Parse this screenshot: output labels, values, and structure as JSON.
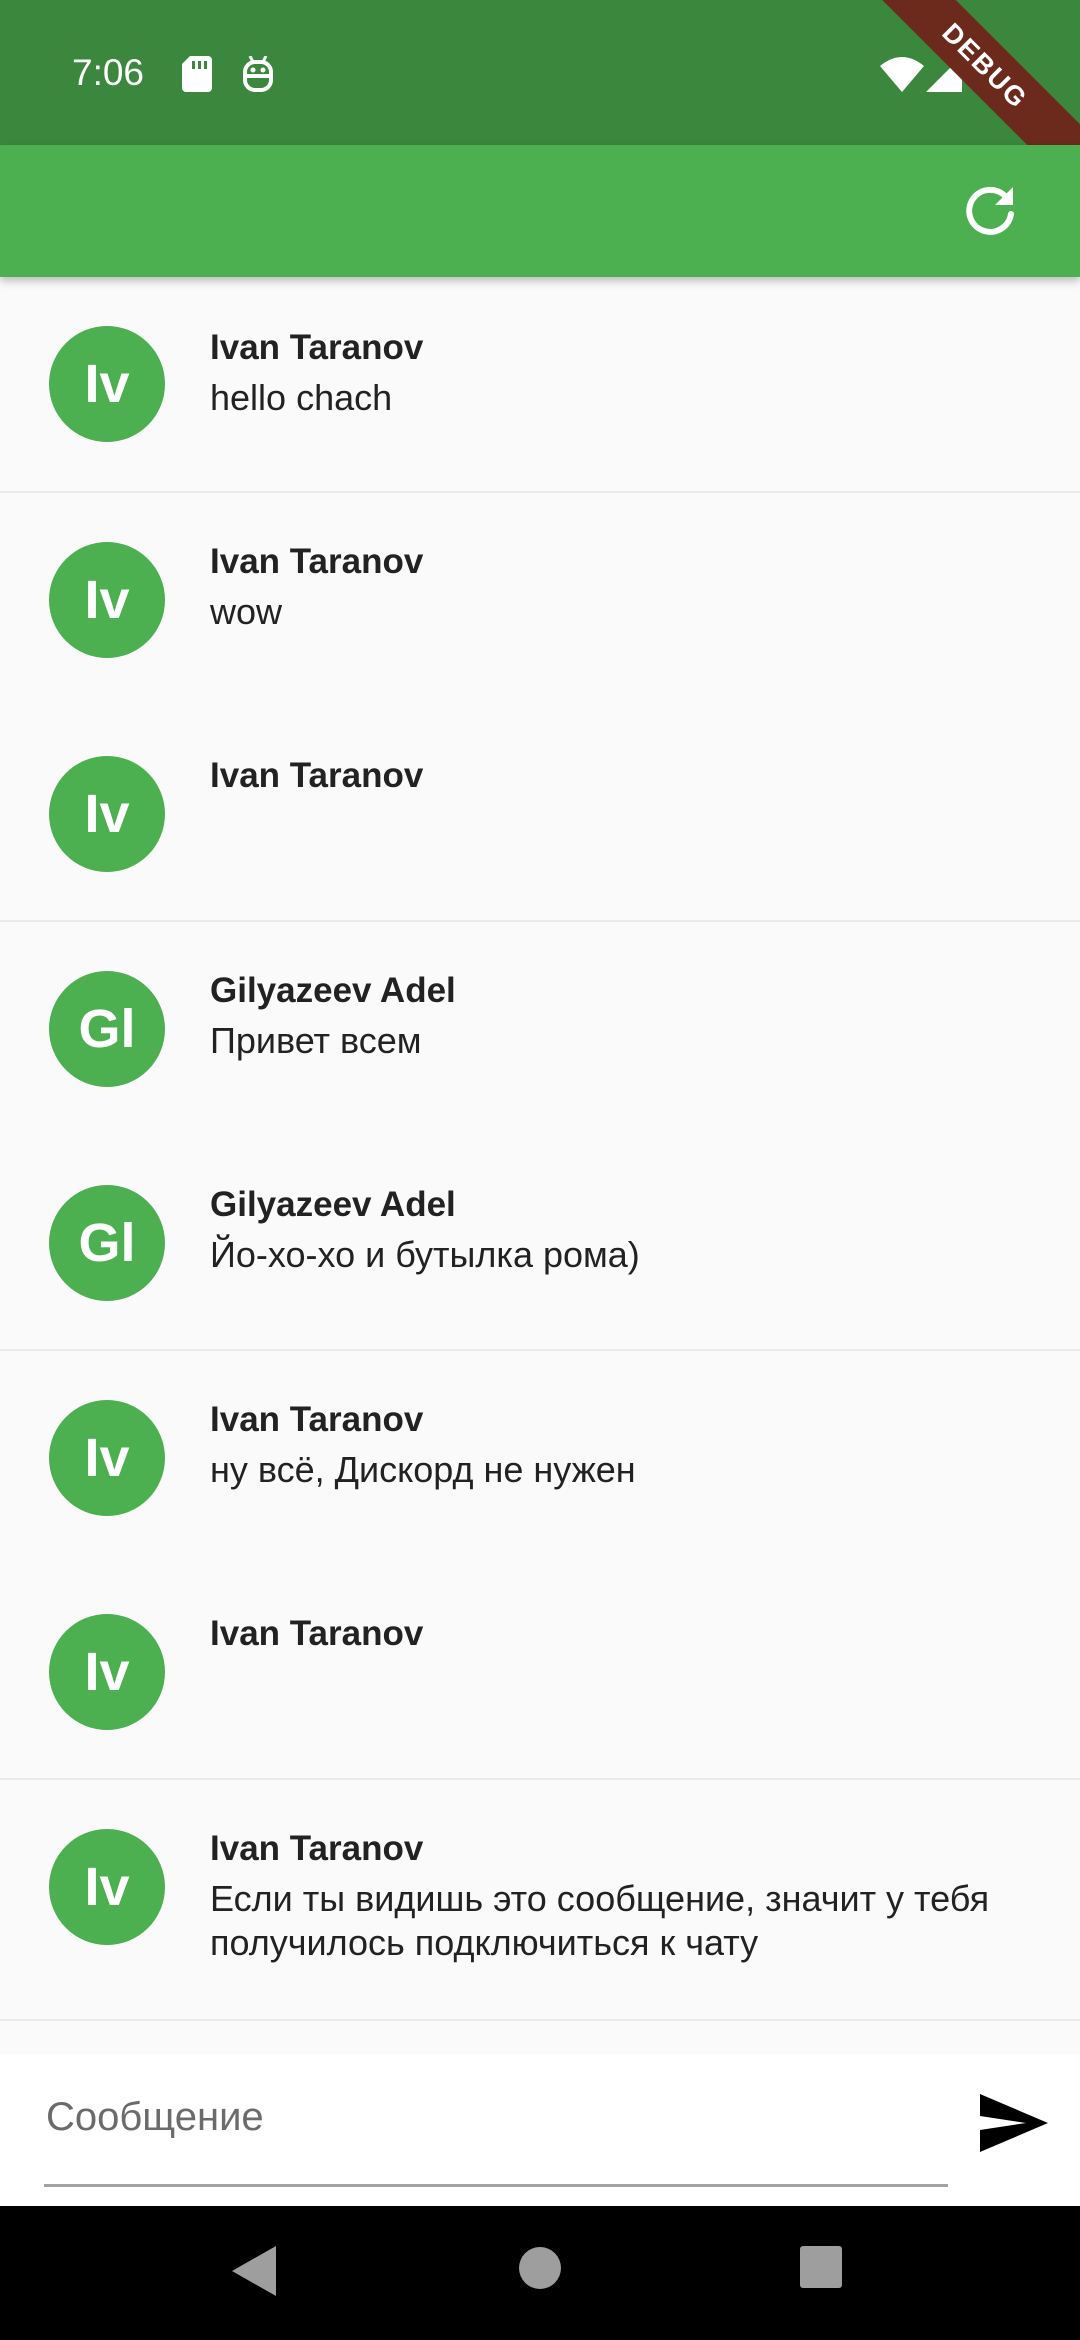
{
  "status_bar": {
    "time": "7:06"
  },
  "debug_banner": {
    "label": "DEBUG"
  },
  "composer": {
    "placeholder": "Сообщение"
  },
  "messages": [
    {
      "initials": "Iv",
      "sender": "Ivan Taranov",
      "text": "hello chach"
    },
    {
      "initials": "Iv",
      "sender": "Ivan Taranov",
      "text": "wow"
    },
    {
      "initials": "Iv",
      "sender": "Ivan Taranov",
      "text": ""
    },
    {
      "initials": "Gl",
      "sender": "Gilyazeev Adel",
      "text": "Привет всем"
    },
    {
      "initials": "Gl",
      "sender": "Gilyazeev Adel",
      "text": "Йо-хо-хо и бутылка рома)"
    },
    {
      "initials": "Iv",
      "sender": "Ivan Taranov",
      "text": "ну всё, Дискорд не нужен"
    },
    {
      "initials": "Iv",
      "sender": "Ivan Taranov",
      "text": ""
    },
    {
      "initials": "Iv",
      "sender": "Ivan Taranov",
      "text": "Если ты видишь это сообщение, значит у тебя получилось подключиться к чату"
    }
  ],
  "colors": {
    "status_bar": "#3b873e",
    "app_bar": "#4caf50",
    "avatar": "#4caf50",
    "debug_banner": "#6b2a1c"
  },
  "icons": [
    "sd-card-icon",
    "android-icon",
    "wifi-icon",
    "cell-signal-icon",
    "battery-icon",
    "refresh-icon",
    "send-icon",
    "back-icon",
    "home-icon",
    "recents-icon"
  ]
}
